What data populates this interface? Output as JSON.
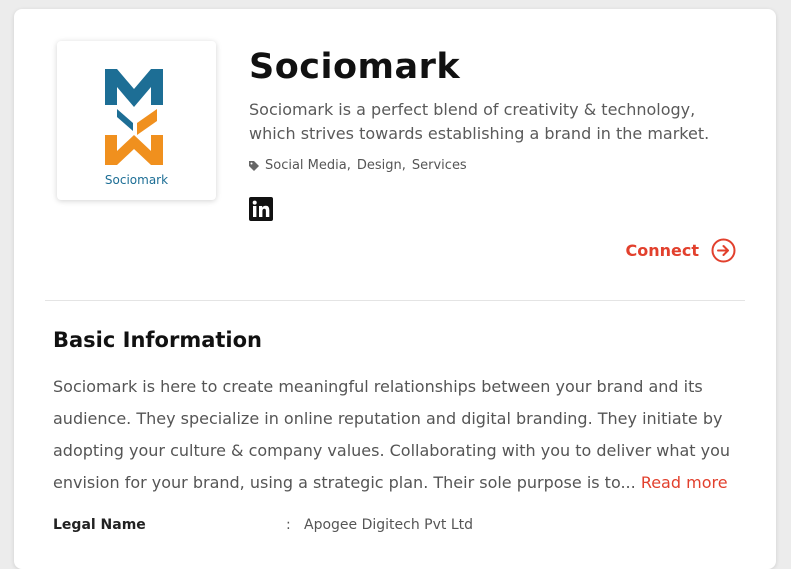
{
  "company": {
    "name": "Sociomark",
    "logo_text": "Sociomark",
    "tagline": "Sociomark is a perfect blend of creativity & technology, which strives towards establishing a brand in the market.",
    "tags": [
      "Social Media,",
      "Design,",
      "Services"
    ],
    "tag_icon": "tag-icon",
    "social_icon": "linkedin-icon"
  },
  "actions": {
    "connect_label": "Connect",
    "connect_icon": "arrow-circle-right-icon"
  },
  "basic_info": {
    "title": "Basic Information",
    "description": "Sociomark is here to create meaningful relationships between your brand and its audience. They specialize in online reputation and digital branding. They initiate by adopting your culture & company values. Collaborating with you to deliver what you envision for your brand, using a strategic plan. Their sole purpose is to...",
    "read_more": "Read more",
    "fields": [
      {
        "label": "Legal Name",
        "separator": ":",
        "value": "Apogee Digitech Pvt Ltd"
      }
    ]
  },
  "colors": {
    "accent": "#e2402d",
    "logo_blue": "#1d6e95",
    "logo_orange": "#f0901e"
  }
}
